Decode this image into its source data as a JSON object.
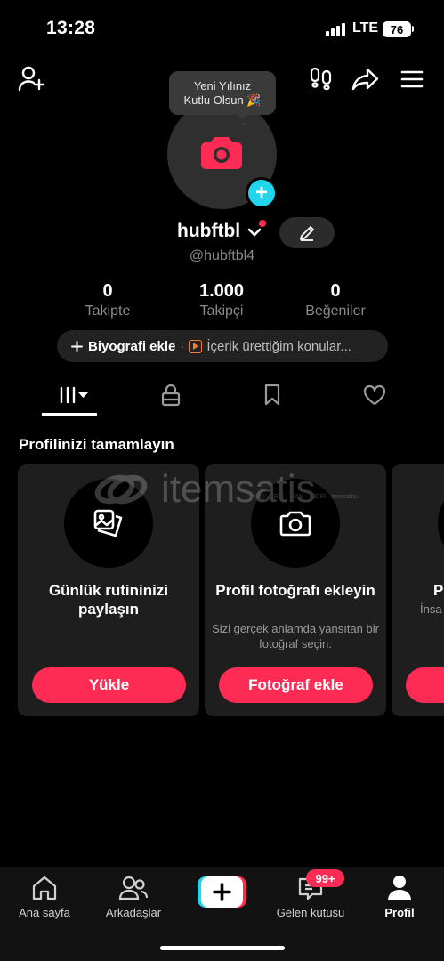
{
  "status_bar": {
    "time": "13:28",
    "network": "LTE",
    "battery": "76"
  },
  "top_bar": {
    "icons": [
      "add-friend-icon",
      "footprints-icon",
      "share-icon",
      "menu-icon"
    ]
  },
  "avatar": {
    "bubble_line1": "Yeni Yılınız",
    "bubble_line2": "Kutlu Olsun 🎉"
  },
  "profile": {
    "username": "hubftbl",
    "handle": "@hubftbl4"
  },
  "stats": [
    {
      "value": "0",
      "label": "Takipte"
    },
    {
      "value": "1.000",
      "label": "Takipçi"
    },
    {
      "value": "0",
      "label": "Beğeniler"
    }
  ],
  "bio": {
    "add_label": "Biyografi ekle",
    "separator": "·",
    "content_label": "İçerik ürettiğim konular..."
  },
  "tabs": [
    "videos-grid-icon",
    "lock-icon",
    "bookmark-icon",
    "heart-icon"
  ],
  "complete_profile": {
    "title": "Profilinizi tamamlayın",
    "cards": [
      {
        "title": "Günlük rutininizi paylaşın",
        "subtitle": "",
        "button": "Yükle",
        "icon": "photos-icon"
      },
      {
        "title": "Profil fotoğrafı ekleyin",
        "subtitle": "Sizi gerçek anlamda yansıtan bir fotoğraf seçin.",
        "button": "Fotoğraf ekle",
        "icon": "camera-icon"
      },
      {
        "title": "P",
        "subtitle": "İnsa",
        "button": "",
        "icon": ""
      }
    ]
  },
  "watermark": {
    "brand": "itemsatis",
    "tagline": "ALIŞVERİŞ · İLAN · İNDİR · itemsatis.com"
  },
  "bottom_nav": {
    "items": [
      {
        "label": "Ana sayfa"
      },
      {
        "label": "Arkadaşlar"
      },
      {
        "label": ""
      },
      {
        "label": "Gelen kutusu",
        "badge": "99+"
      },
      {
        "label": "Profil"
      }
    ]
  },
  "colors": {
    "accent": "#fe2c55",
    "cyan": "#20d5ec",
    "card_bg": "#1e1e1e"
  }
}
